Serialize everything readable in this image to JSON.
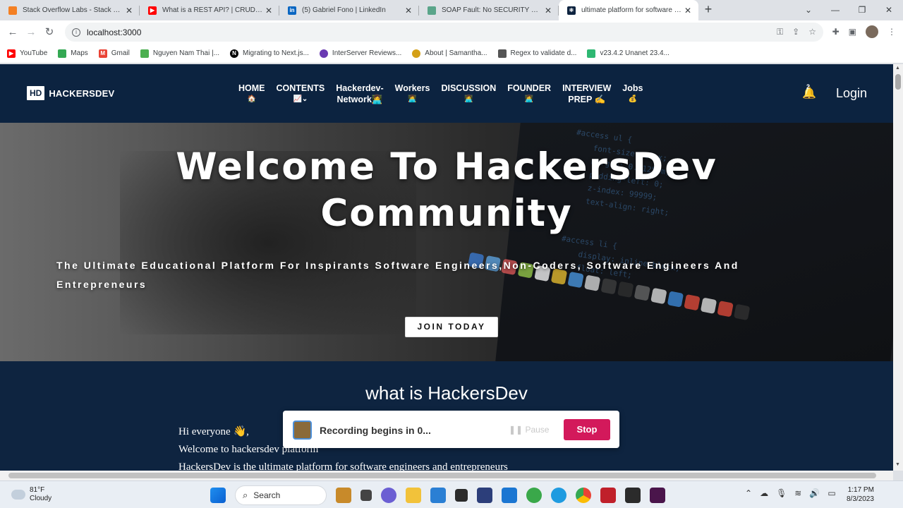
{
  "browser": {
    "tabs": [
      {
        "title": "Stack Overflow Labs - Stack Overflow",
        "favicon_color": "#f48024",
        "active": false
      },
      {
        "title": "What is a REST API? | CRUD API",
        "favicon_color": "#ff0000",
        "active": false
      },
      {
        "title": "(5) Gabriel Fono | LinkedIn",
        "favicon_color": "#0a66c2",
        "active": false
      },
      {
        "title": "SOAP Fault: No SECURITY Header",
        "favicon_color": "#5aa58a",
        "active": false
      },
      {
        "title": "ultimate platform for software engineers",
        "favicon_color": "#0e2440",
        "active": true
      }
    ],
    "new_tab": "+",
    "url": "localhost:3000",
    "bookmarks": [
      {
        "label": "YouTube",
        "color": "#ff0000"
      },
      {
        "label": "Maps",
        "color": "#34a853"
      },
      {
        "label": "Gmail",
        "color": "#ea4335"
      },
      {
        "label": "Nguyen Nam Thai |...",
        "color": "#4caf50"
      },
      {
        "label": "Migrating to Next.js...",
        "color": "#000000"
      },
      {
        "label": "InterServer Reviews...",
        "color": "#6a3ab2"
      },
      {
        "label": "About | Samantha...",
        "color": "#d4a017"
      },
      {
        "label": "Regex to validate d...",
        "color": "#555555"
      },
      {
        "label": "v23.4.2 Unanet 23.4...",
        "color": "#2eb872"
      }
    ]
  },
  "site": {
    "logo_box": "HD",
    "logo_text": "HACKERSDEV",
    "menu": [
      {
        "line1": "HOME",
        "line2": "🏠"
      },
      {
        "line1": "CONTENTS",
        "line2": "📈⌄"
      },
      {
        "line1": "Hackerdev-",
        "line2": "Network👩‍💻"
      },
      {
        "line1": "Workers",
        "line2": "👩‍💻"
      },
      {
        "line1": "DISCUSSION",
        "line2": "👩‍💻"
      },
      {
        "line1": "FOUNDER",
        "line2": "👩‍💻"
      },
      {
        "line1": "INTERVIEW",
        "line2": "PREP ✍"
      },
      {
        "line1": "Jobs",
        "line2": "💰"
      }
    ],
    "notification_count": "2",
    "login": "Login",
    "hero_title_line1": "Welcome To HackersDev",
    "hero_title_line2": "Community",
    "hero_sub": "The Ultimate Educational Platform For Inspirants Software Engineers,Non-Coders, Software Engineers And Entrepreneurs",
    "join_button": "JOIN TODAY",
    "section_title": "what is HackersDev",
    "paragraphs": [
      "Hi everyone 👋,",
      "Welcome to hackersdev platform",
      "HackersDev is the ultimate platform for software engineers and entrepreneurs"
    ]
  },
  "recording": {
    "text": "Recording begins in 0...",
    "pause": "❚❚ Pause",
    "stop": "Stop"
  },
  "taskbar": {
    "temperature": "81°F",
    "condition": "Cloudy",
    "search": "Search",
    "time": "1:17 PM",
    "date": "8/3/2023"
  }
}
